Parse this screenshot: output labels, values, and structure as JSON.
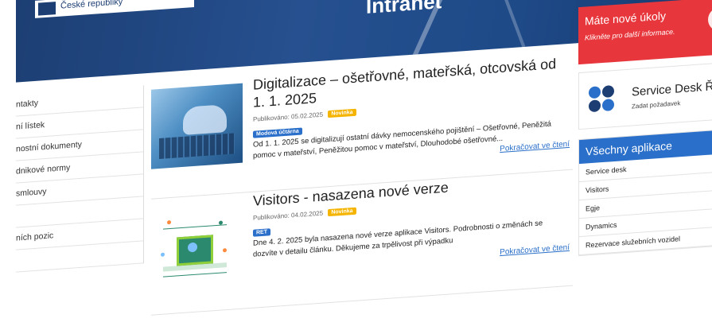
{
  "header": {
    "logo_text": "České republiky",
    "title": "Intranet"
  },
  "sidebar": {
    "items": [
      {
        "label": "ntakty"
      },
      {
        "label": "ní lístek"
      },
      {
        "label": "nostní dokumenty"
      },
      {
        "label": "dnikové normy"
      },
      {
        "label": "smlouvy"
      },
      {
        "label": ""
      },
      {
        "label": "ních pozic"
      },
      {
        "label": ""
      }
    ]
  },
  "articles": [
    {
      "title": "Digitalizace – ošetřovné, mateřská, otcovská od 1. 1. 2025",
      "published": "Publikováno: 05.02.2025",
      "badge_new": "Novinka",
      "tag": "Modová účtárna",
      "text": "Od 1. 1. 2025 se digitalizují ostatní dávky nemocenského pojištění – Ošetřovné, Peněžitá pomoc v mateřství, Peněžitou pomoc v mateřství, Dlouhodobé ošetřovné...",
      "more": "Pokračovat ve čtení"
    },
    {
      "title": "Visitors - nasazena nové verze",
      "published": "Publikováno: 04.02.2025",
      "badge_new": "Novinka",
      "tag": "RET",
      "text": "Dne 4. 2. 2025 byla nasazena nové verze aplikace Visitors. Podrobnosti o změnách se dozvíte v detailu článku. Děkujeme za trpělivost při výpadku",
      "more": "Pokračovat ve čtení"
    }
  ],
  "tasks": {
    "title": "Máte nové úkoly",
    "subtitle": "Klikněte pro další informace."
  },
  "service_desk": {
    "title": "Service Desk ŘL",
    "subtitle": "Zadat požadavek"
  },
  "apps": {
    "title": "Všechny aplikace",
    "items": [
      "Service desk",
      "Visitors",
      "Egje",
      "Dynamics",
      "Rezervace služebních vozidel"
    ]
  },
  "colors": {
    "brand_blue": "#1c3e73",
    "accent_blue": "#2a6fc9",
    "alert_red": "#e8373c",
    "badge_yellow": "#f5b400"
  }
}
